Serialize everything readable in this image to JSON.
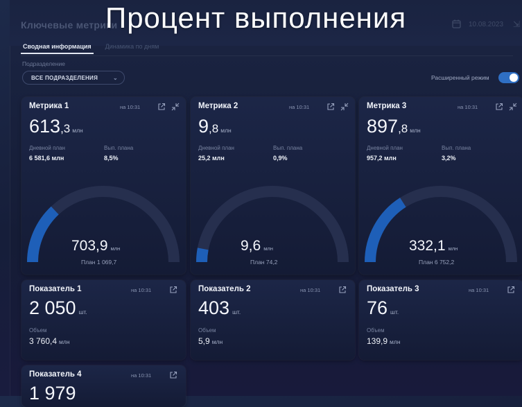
{
  "overlay_title": "Процент выполнения",
  "header": {
    "app_title": "Ключевые метрики",
    "date": "10.08.2023"
  },
  "tabs": [
    {
      "label": "Сводная информация",
      "active": true
    },
    {
      "label": "Динамика по дням",
      "active": false
    }
  ],
  "filters": {
    "division_label": "Подразделение",
    "division_value": "ВСЕ ПОДРАЗДЕЛЕНИЯ",
    "advanced_mode_label": "Расширенный режим",
    "advanced_mode_on": true
  },
  "metrics": [
    {
      "title": "Метрика 1",
      "time": "на 10:31",
      "value_int": "613",
      "value_dec": ",3",
      "unit": "млн",
      "daily_plan_label": "Дневной план",
      "daily_plan": "6 581,6 млн",
      "exec_label": "Вып. плана",
      "exec": "8,5%",
      "gauge_value": "703,9",
      "gauge_unit": "млн",
      "gauge_plan": "План 1 069,7",
      "gauge_fraction": 0.26
    },
    {
      "title": "Метрика 2",
      "time": "на 10:31",
      "value_int": "9",
      "value_dec": ",8",
      "unit": "млн",
      "daily_plan_label": "Дневной план",
      "daily_plan": "25,2 млн",
      "exec_label": "Вып. плана",
      "exec": "0,9%",
      "gauge_value": "9,6",
      "gauge_unit": "млн",
      "gauge_plan": "План 74,2",
      "gauge_fraction": 0.06
    },
    {
      "title": "Метрика 3",
      "time": "на 10:31",
      "value_int": "897",
      "value_dec": ",8",
      "unit": "млн",
      "daily_plan_label": "Дневной план",
      "daily_plan": "957,2 млн",
      "exec_label": "Вып. плана",
      "exec": "3,2%",
      "gauge_value": "332,1",
      "gauge_unit": "млн",
      "gauge_plan": "План 6 752,2",
      "gauge_fraction": 0.32
    }
  ],
  "indicators": [
    {
      "title": "Показатель 1",
      "time": "на 10:31",
      "value": "2 050",
      "unit": "шт.",
      "volume_label": "Объем",
      "volume": "3 760,4",
      "volume_unit": "млн"
    },
    {
      "title": "Показатель 2",
      "time": "на 10:31",
      "value": "403",
      "unit": "шт.",
      "volume_label": "Объем",
      "volume": "5,9",
      "volume_unit": "млн"
    },
    {
      "title": "Показатель 3",
      "time": "на 10:31",
      "value": "76",
      "unit": "шт.",
      "volume_label": "Объем",
      "volume": "139,9",
      "volume_unit": "млн"
    },
    {
      "title": "Показатель 4",
      "time": "на 10:31",
      "value": "1 979"
    }
  ],
  "colors": {
    "gauge_fill": "#1e5fb8",
    "gauge_track": "#262f4e",
    "toggle_on": "#2f6fc4"
  }
}
